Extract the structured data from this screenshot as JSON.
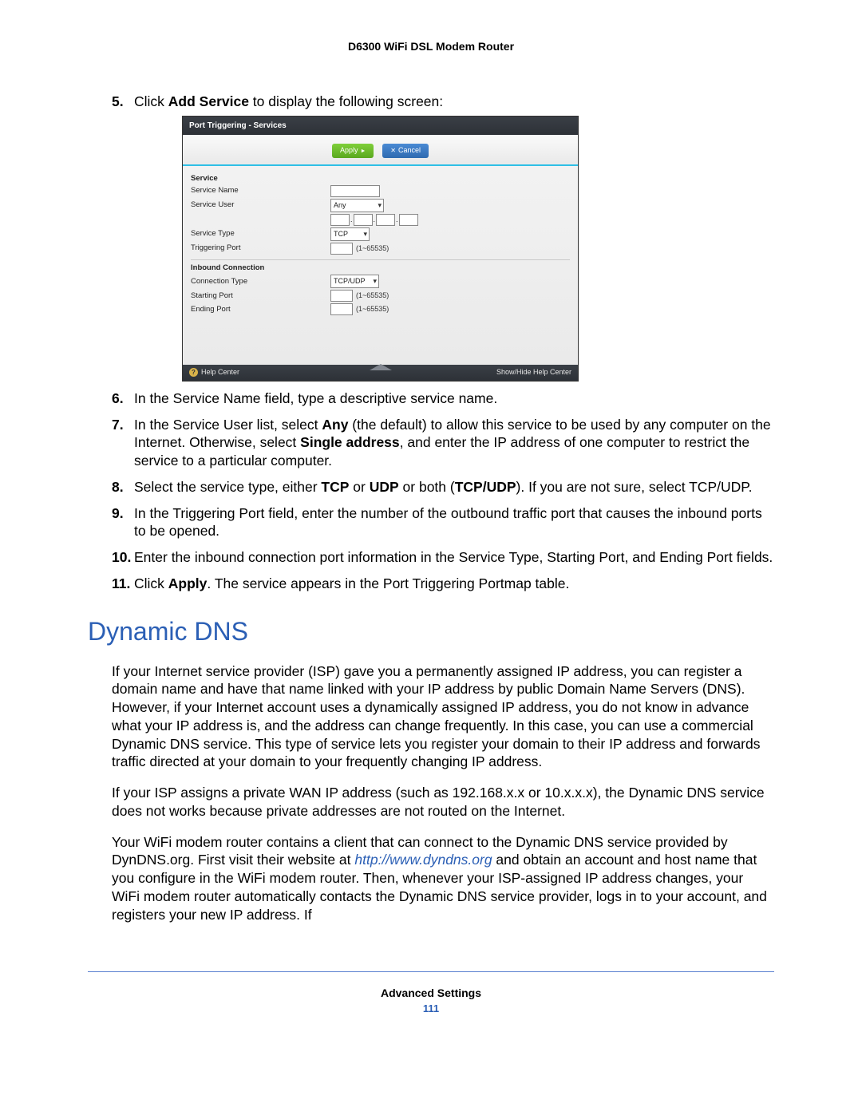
{
  "header": {
    "title": "D6300 WiFi DSL Modem Router"
  },
  "steps": {
    "s5_prefix": "Click ",
    "s5_bold": "Add Service",
    "s5_suffix": " to display the following screen:",
    "s6": "In the Service Name field, type a descriptive service name.",
    "s7_a": "In the Service User list, select ",
    "s7_b": "Any",
    "s7_c": " (the default) to allow this service to be used by any computer on the Internet. Otherwise, select ",
    "s7_d": "Single address",
    "s7_e": ", and enter the IP address of one computer to restrict the service to a particular computer.",
    "s8_a": "Select the service type, either ",
    "s8_b": "TCP",
    "s8_c": " or ",
    "s8_d": "UDP",
    "s8_e": " or both (",
    "s8_f": "TCP/UDP",
    "s8_g": "). If you are not sure, select TCP/UDP.",
    "s9": "In the Triggering Port field, enter the number of the outbound traffic port that causes the inbound ports to be opened.",
    "s10": "Enter the inbound connection port information in the Service Type, Starting Port, and Ending Port fields.",
    "s11_a": "Click ",
    "s11_b": "Apply",
    "s11_c": ". The service appears in the Port Triggering Portmap table."
  },
  "screenshot": {
    "title": "Port Triggering - Services",
    "apply": "Apply",
    "cancel": "Cancel",
    "service_section": "Service",
    "service_name": "Service Name",
    "service_user": "Service User",
    "service_user_value": "Any",
    "service_type": "Service Type",
    "service_type_value": "TCP",
    "triggering_port": "Triggering Port",
    "range": "(1~65535)",
    "inbound_section": "Inbound Connection",
    "connection_type": "Connection Type",
    "connection_type_value": "TCP/UDP",
    "starting_port": "Starting Port",
    "ending_port": "Ending Port",
    "help_center": "Help Center",
    "show_hide": "Show/Hide Help Center"
  },
  "section": {
    "heading": "Dynamic DNS",
    "p1": "If your Internet service provider (ISP) gave you a permanently assigned IP address, you can register a domain name and have that name linked with your IP address by public Domain Name Servers (DNS). However, if your Internet account uses a dynamically assigned IP address, you do not know in advance what your IP address is, and the address can change frequently. In this case, you can use a commercial Dynamic DNS service. This type of service lets you register your domain to their IP address and forwards traffic directed at your domain to your frequently changing IP address.",
    "p2": "If your ISP assigns a private WAN IP address (such as 192.168.x.x or 10.x.x.x), the Dynamic DNS service does not works because private addresses are not routed on the Internet.",
    "p3_a": "Your WiFi modem router contains a client that can connect to the Dynamic DNS service provided by DynDNS.org. First visit their website at ",
    "p3_link": "http://www.dyndns.org",
    "p3_b": " and obtain an account and host name that you configure in the WiFi modem router. Then, whenever your ISP-assigned IP address changes, your WiFi modem router automatically contacts the Dynamic DNS service provider, logs in to your account, and registers your new IP address. If"
  },
  "footer": {
    "label": "Advanced Settings",
    "page": "111"
  }
}
